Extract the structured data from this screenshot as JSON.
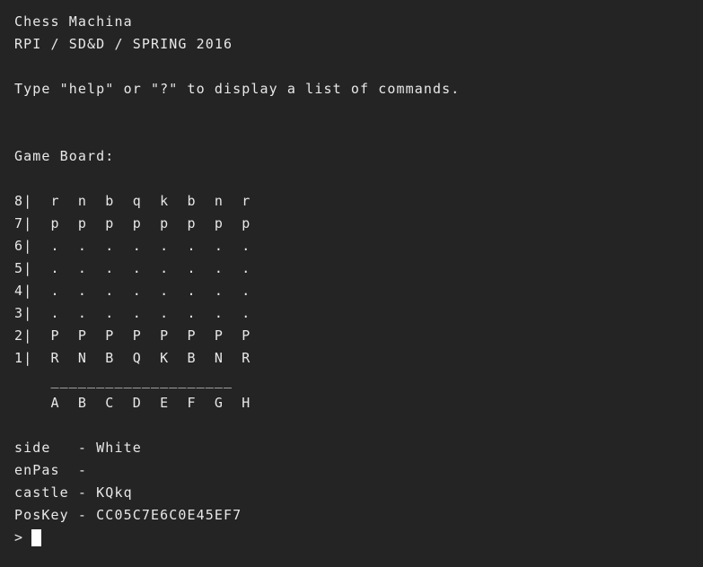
{
  "terminal": {
    "background_color": "#242424",
    "text_color": "#e8e8e8",
    "cursor_color": "#ffffff"
  },
  "header": {
    "title": "Chess Machina",
    "subtitle": "RPI / SD&D / SPRING 2016"
  },
  "help_hint": "Type \"help\" or \"?\" to display a list of commands.",
  "board_heading": "Game Board:",
  "board": {
    "rows": [
      "8|  r  n  b  q  k  b  n  r",
      "7|  p  p  p  p  p  p  p  p",
      "6|  .  .  .  .  .  .  .  .",
      "5|  .  .  .  .  .  .  .  .",
      "4|  .  .  .  .  .  .  .  .",
      "3|  .  .  .  .  .  .  .  .",
      "2|  P  P  P  P  P  P  P  P",
      "1|  R  N  B  Q  K  B  N  R"
    ],
    "separator": "    ____________________",
    "files": "    A  B  C  D  E  F  G  H"
  },
  "status": {
    "side": "side   - White",
    "enpas": "enPas  -",
    "castle": "castle - KQkq",
    "poskey": "PosKey - CC05C7E6C0E45EF7"
  },
  "prompt": {
    "symbol": ">"
  }
}
